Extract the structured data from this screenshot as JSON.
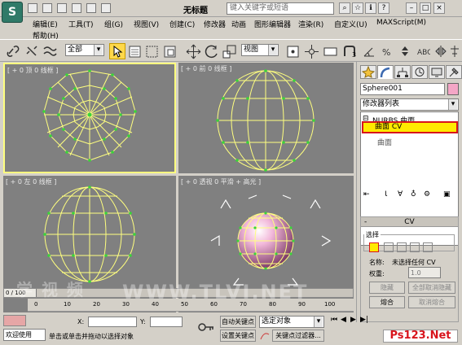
{
  "window": {
    "title": "无标题",
    "search_placeholder": "键入关键字或短语"
  },
  "menus": {
    "row1": [
      "编辑(E)",
      "工具(T)",
      "组(G)",
      "视图(V)",
      "创建(C)",
      "修改器",
      "动画",
      "图形编辑器",
      "渲染(R)",
      "自定义(U)",
      "MAXScript(M)"
    ],
    "row2": [
      "帮助(H)"
    ]
  },
  "toolbar": {
    "filter_value": "全部",
    "view_value": "视图",
    "snap_count": "3"
  },
  "viewports": {
    "top_left_label": "[ + 0 顶 0 线框 ]",
    "top_right_label": "[ + 0 前 0 线框 ]",
    "bottom_left_label": "[ + 0 左 0 线框 ]",
    "bottom_right_label": "[ + 0 透视 0 平滑 + 高光 ]"
  },
  "panel": {
    "object_name": "Sphere001",
    "object_color": "#f4a6c6",
    "modifier_list_label": "修改器列表",
    "stack": {
      "root": "NURBS 曲面",
      "selected": "曲面 CV",
      "child": "曲面"
    },
    "rollout_title": "CV",
    "select_label": "选择",
    "name_label": "名称:",
    "name_value": "未选择任何 CV",
    "weight_label": "权重:",
    "weight_value": "1.0",
    "hide_button": "隐藏",
    "unhide_all_button": "全部取消隐藏",
    "fuse_button": "熔合",
    "unfuse_button": "取消熔合"
  },
  "timeline": {
    "frame_label": "0 / 100",
    "ticks": [
      "0",
      "10",
      "20",
      "30",
      "40",
      "50",
      "60",
      "70",
      "80",
      "90",
      "100"
    ]
  },
  "status": {
    "welcome": "欢迎使用",
    "x_label": "X:",
    "y_label": "Y:",
    "prompt": "单击或单击并拖动以选择对象",
    "auto_key": "自动关键点",
    "set_key": "设置关键点",
    "key_filters": "关键点过滤器...",
    "selected_object": "选定对象"
  },
  "watermark": {
    "left": "学 视 频",
    "right": "WWW.TLVI.NET",
    "ps": "Ps123.Net"
  },
  "colors": {
    "accent_yellow": "#ffea00",
    "highlight_red": "#d8141c",
    "viewport_bg": "#808080",
    "ui_bg": "#d4d0c8",
    "wire": "#ffff7f",
    "vertex": "#3ad43a"
  }
}
